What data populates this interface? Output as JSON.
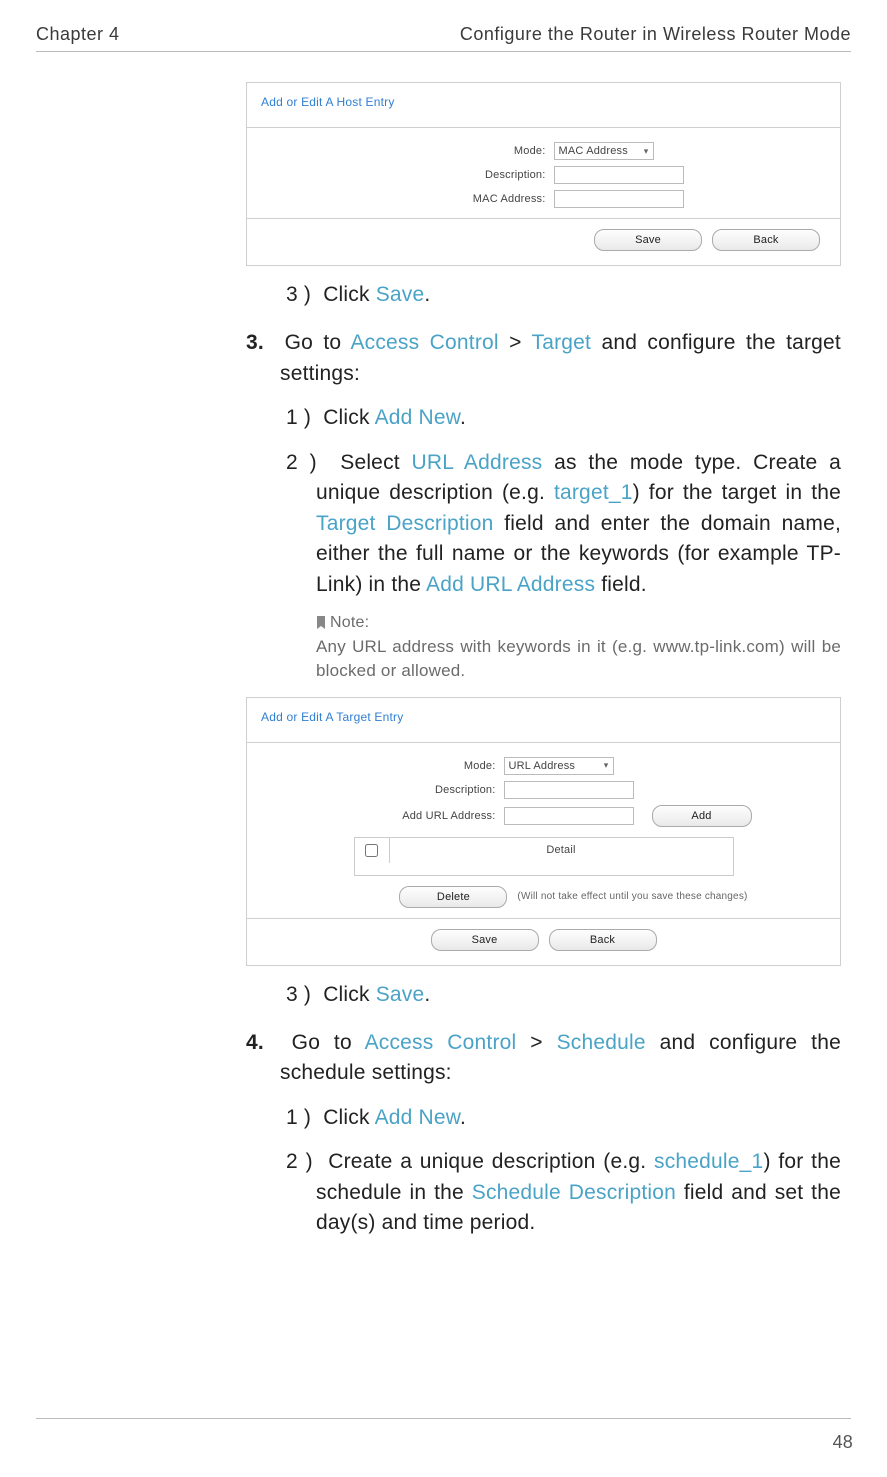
{
  "header": {
    "chapter": "Chapter 4",
    "title": "Configure the Router in Wireless Router Mode"
  },
  "screenshot_host": {
    "title": "Add or Edit A Host Entry",
    "labels": {
      "mode": "Mode:",
      "description": "Description:",
      "mac": "MAC Address:"
    },
    "mode_value": "MAC Address",
    "buttons": {
      "save": "Save",
      "back": "Back"
    }
  },
  "step_host_sub3": {
    "marker": "3 )",
    "prefix": "Click ",
    "link": "Save",
    "suffix": "."
  },
  "step3": {
    "marker": "3.",
    "text_before": "Go to ",
    "link1": "Access Control",
    "sep": " > ",
    "link2": "Target",
    "text_after": " and configure the target settings:"
  },
  "step3_sub1": {
    "marker": "1 )",
    "prefix": "Click ",
    "link": "Add New",
    "suffix": "."
  },
  "step3_sub2": {
    "marker": "2 )",
    "t1": "Select ",
    "l1": "URL Address",
    "t2": " as the mode type. Create a unique description (e.g. ",
    "l2": "target_1",
    "t3": ") for the target in the ",
    "l3": "Target Description",
    "t4": " field and enter the domain name, either the full name or the keywords (for example TP-Link) in the ",
    "l4": "Add URL Address",
    "t5": " field."
  },
  "note": {
    "label": "Note:",
    "body": "Any URL address with keywords in it (e.g. www.tp-link.com) will be blocked or allowed."
  },
  "screenshot_target": {
    "title": "Add or Edit A Target Entry",
    "labels": {
      "mode": "Mode:",
      "description": "Description:",
      "url": "Add URL Address:"
    },
    "mode_value": "URL Address",
    "buttons": {
      "add": "Add",
      "delete": "Delete",
      "save": "Save",
      "back": "Back"
    },
    "detail_header": "Detail",
    "delete_hint": "(Will not take effect until you save these changes)"
  },
  "step_target_sub3": {
    "marker": "3 )",
    "prefix": "Click ",
    "link": "Save",
    "suffix": "."
  },
  "step4": {
    "marker": "4.",
    "text_before": "Go to ",
    "link1": "Access Control",
    "sep": " > ",
    "link2": "Schedule",
    "text_after": " and configure the schedule settings:"
  },
  "step4_sub1": {
    "marker": "1 )",
    "prefix": "Click ",
    "link": "Add New",
    "suffix": "."
  },
  "step4_sub2": {
    "marker": "2 )",
    "t1": "Create a unique description (e.g. ",
    "l1": "schedule_1",
    "t2": ") for the schedule in the ",
    "l2": "Schedule Description",
    "t3": " field and set the day(s) and time period."
  },
  "page_number": "48"
}
